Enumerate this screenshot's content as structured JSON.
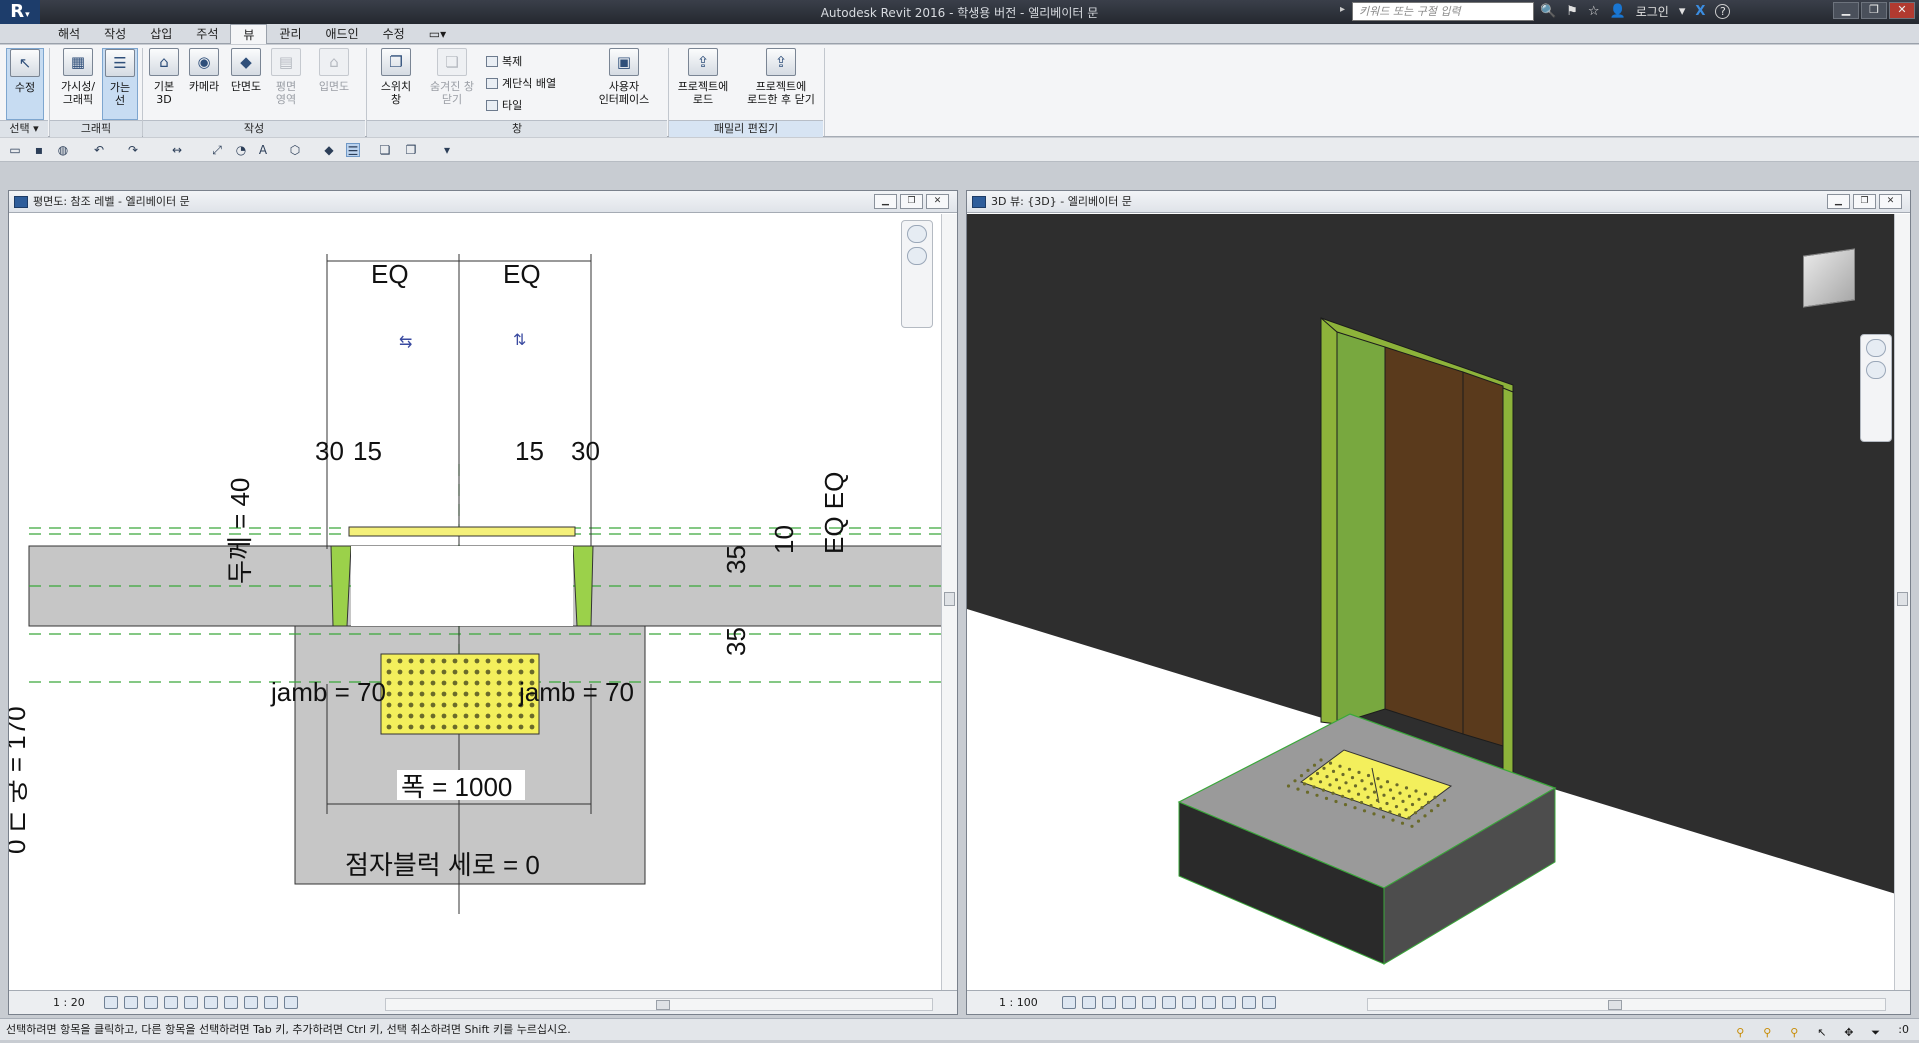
{
  "title": {
    "logo": "R",
    "window_title": "Autodesk Revit 2016 - 학생용 버전 -  엘리베이터 문",
    "search_placeholder": "키워드 또는 구절 입력",
    "login_label": "로그인",
    "help_label": "?"
  },
  "menu_tabs": [
    "해석",
    "작성",
    "삽입",
    "주석",
    "뷰",
    "관리",
    "애드인",
    "수정",
    "▭▾"
  ],
  "active_tab_index": 4,
  "ribbon": {
    "select_label": "선택 ▾",
    "buttons": {
      "modify": "수정",
      "visibility": "가시성/\n그래픽",
      "thin_lines": "가는\n선",
      "default3d": "기본\n3D",
      "camera": "카메라",
      "section": "단면도",
      "plan_region": "평면\n영역",
      "elevation": "입면도",
      "switch_window": "스위치\n창",
      "close_hidden": "숨겨진 창\n닫기",
      "user_interface": "사용자\n인터페이스",
      "load_project": "프로젝트에\n로드",
      "load_close": "프로젝트에\n로드한 후 닫기"
    },
    "small_buttons": {
      "replicate": "복제",
      "cascade": "계단식 배열",
      "tile": "타일"
    },
    "panels": {
      "select": "선택",
      "graphics": "그래픽",
      "create": "작성",
      "windows": "창",
      "family_editor": "패밀리 편집기"
    }
  },
  "views": {
    "plan": {
      "title": "평면도: 참조 레벨 - 엘리베이터 문",
      "scale": "1 : 20",
      "annotations": {
        "eq_left": "EQ",
        "eq_right": "EQ",
        "dim_30_left": "30",
        "dim_15_left": "15",
        "dim_15_right": "15",
        "dim_30_right": "30",
        "thickness": "두께 = 40",
        "dim_35_top": "35",
        "dim_10": "10",
        "eq_eq": "EQ EQ",
        "dim_35_bottom": "35",
        "jamb_left": "jamb = 70",
        "jamb_right": "jamb = 70",
        "width": "폭 = 1000",
        "braille_height": "점자블럭 세로 = 0",
        "left_vertical": "0 ⊏ 궁 = 170"
      }
    },
    "view3d": {
      "title": "3D 뷰: {3D} - 엘리베이터 문",
      "scale": "1 : 100"
    }
  },
  "status": {
    "message": "선택하려면 항목을 클릭하고, 다른 항목을 선택하려면 Tab 키, 추가하려면 Ctrl 키, 선택 취소하려면 Shift 키를 누르십시오.",
    "filter_count": ":0"
  },
  "colors": {
    "accent_green": "#8db33a",
    "door_brown": "#5a3a1c",
    "wall_dark": "#2e2e2e",
    "braille_yellow": "#f3ef5c",
    "slab_grey": "#c6c6c6"
  }
}
